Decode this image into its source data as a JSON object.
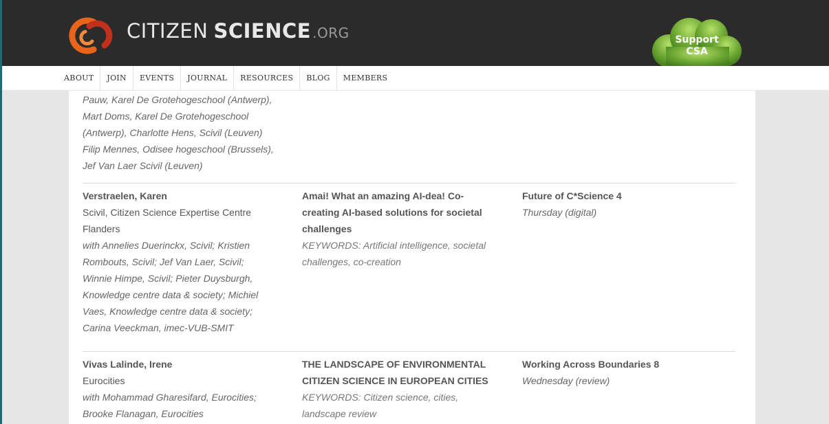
{
  "site": {
    "name_part1": "CITIZEN",
    "name_part2": "SCIENCE",
    "name_part3": ".ORG",
    "support_line1": "Support",
    "support_line2": "CSA"
  },
  "colors": {
    "header_bg": "#2b2b2b",
    "logo_orange": "#e8641b",
    "logo_red": "#c0301c",
    "support_green": "#6aa531"
  },
  "nav": [
    "ABOUT",
    "JOIN",
    "EVENTS",
    "JOURNAL",
    "RESOURCES",
    "BLOG",
    "MEMBERS"
  ],
  "entries": [
    {
      "author": "",
      "affiliation": "",
      "coauthors": [
        "Pauw, Karel De Grotehogeschool (Antwerp),",
        "Mart Doms, Karel De Grotehogeschool",
        "(Antwerp), Charlotte Hens, Scivil (Leuven)",
        "Filip Mennes, Odisee hogeschool (Brussels),",
        "Jef Van Laer Scivil (Leuven)"
      ],
      "title": [],
      "keywords": [],
      "session": "",
      "day": ""
    },
    {
      "author": "Verstraelen, Karen",
      "affiliation": [
        "Scivil, Citizen Science Expertise Centre",
        "Flanders"
      ],
      "coauthors": [
        "with Annelies Duerinckx, Scivil; Kristien",
        "Rombouts, Scivil; Jef Van Laer, Scivil;",
        "Winnie Himpe, Scivil; Pieter Duysburgh,",
        "Knowledge centre data & society; Michiel",
        "Vaes, Knowledge centre data & society;",
        "Carina Veeckman, imec-VUB-SMIT"
      ],
      "title": [
        "Amai! What an amazing AI-dea! Co-",
        "creating AI-based solutions for societal",
        "challenges"
      ],
      "keywords": [
        "KEYWORDS: Artificial intelligence, societal",
        "challenges, co-creation"
      ],
      "session": "Future of C*Science 4",
      "day": "Thursday (digital)"
    },
    {
      "author": "Vivas Lalinde, Irene",
      "affiliation": [
        "Eurocities"
      ],
      "coauthors": [
        "with Mohammad Gharesifard, Eurocities;",
        "Brooke Flanagan, Eurocities"
      ],
      "title": [
        "THE LANDSCAPE OF ENVIRONMENTAL",
        "CITIZEN SCIENCE IN EUROPEAN CITIES"
      ],
      "keywords": [
        "KEYWORDS: Citizen science, cities,",
        "landscape review"
      ],
      "session": "Working Across Boundaries 8",
      "day": "Wednesday (review)"
    }
  ]
}
